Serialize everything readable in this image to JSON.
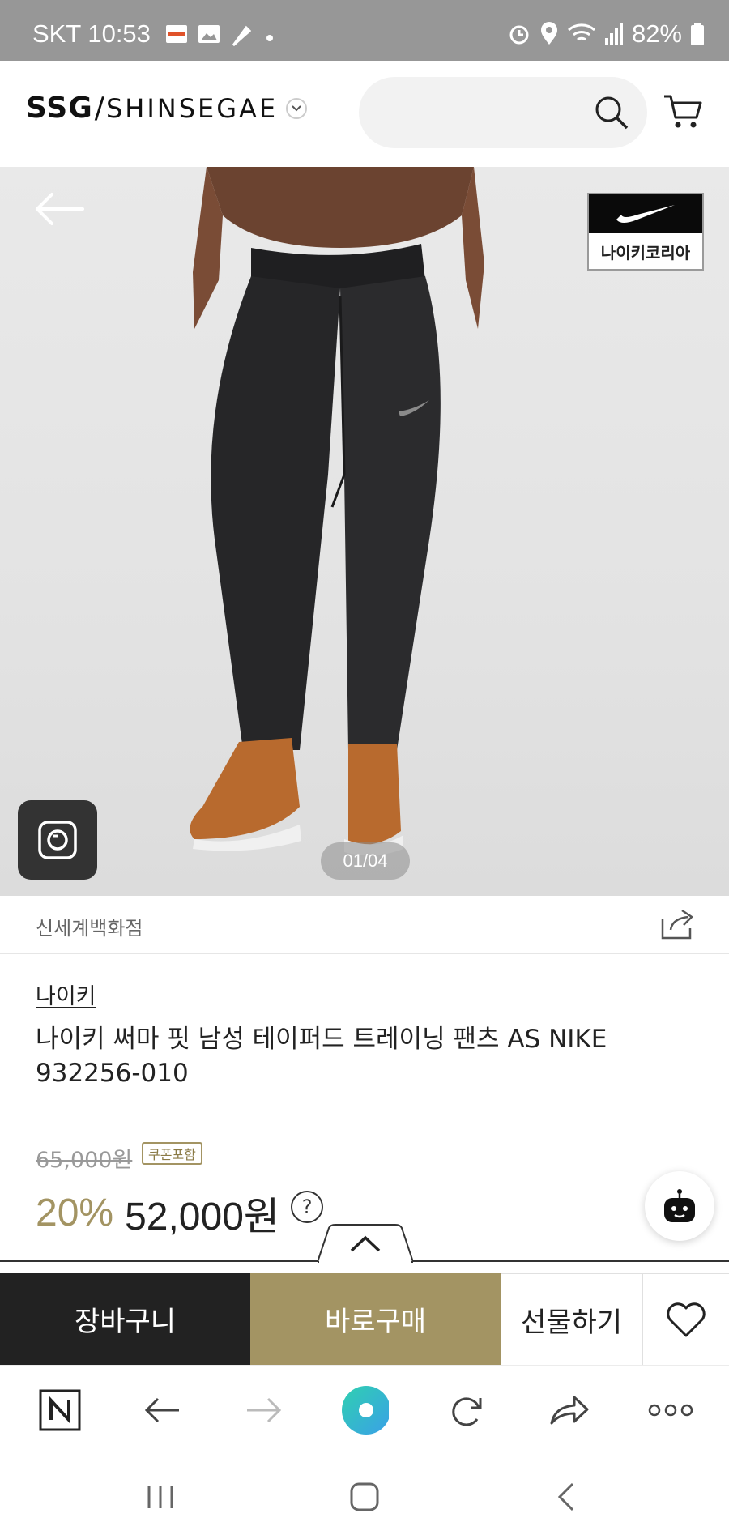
{
  "status_bar": {
    "carrier_time": "SKT 10:53",
    "battery": "82%",
    "icons": [
      "flag-icon",
      "image-icon",
      "feather-icon",
      "dot-icon",
      "alarm-icon",
      "location-icon",
      "wifi-icon",
      "signal-icon",
      "battery-icon"
    ]
  },
  "header": {
    "logo_ssg": "SSG",
    "logo_slash": "/",
    "logo_shinsegae": "SHINSEGAE",
    "search_placeholder": ""
  },
  "hero": {
    "brand_badge_text": "나이키코리아",
    "pager": "01/04"
  },
  "seller": {
    "name": "신세계백화점"
  },
  "product": {
    "brand": "나이키",
    "title": "나이키 써마 핏 남성 테이퍼드 트레이닝 팬츠 AS NIKE 932256-010",
    "original_price": "65,000원",
    "coupon_tag": "쿠폰포함",
    "discount": "20%",
    "sale_price": "52,000원",
    "help": "?"
  },
  "actions": {
    "cart": "장바구니",
    "buy_now": "바로구매",
    "gift": "선물하기"
  },
  "browser_toolbar": {
    "items": [
      "naver-n-icon",
      "back-icon",
      "forward-icon",
      "home-orb-icon",
      "refresh-icon",
      "share-icon",
      "more-icon"
    ]
  },
  "colors": {
    "accent_gold": "#a39463",
    "dark": "#222222",
    "status_bar": "#979797"
  }
}
